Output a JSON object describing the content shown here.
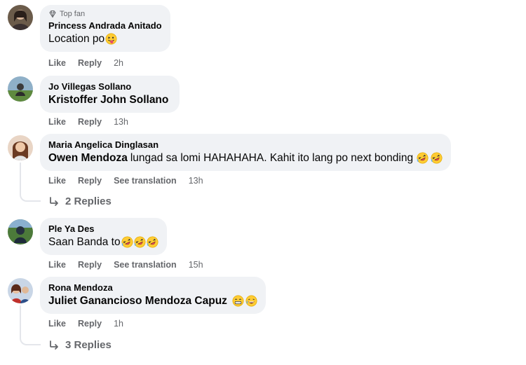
{
  "comments": [
    {
      "badge": "Top fan",
      "author": "Princess Andrada Anitado",
      "tag": "",
      "text": "Location po",
      "emojis": [
        "tongue"
      ],
      "like": "Like",
      "reply": "Reply",
      "translation": "",
      "time": "2h"
    },
    {
      "badge": "",
      "author": "Jo Villegas Sollano",
      "tag": "Kristoffer John Sollano",
      "text": "",
      "emojis": [],
      "like": "Like",
      "reply": "Reply",
      "translation": "",
      "time": "13h"
    },
    {
      "badge": "",
      "author": "Maria Angelica Dinglasan",
      "tag": "Owen Mendoza",
      "text": "lungad sa lomi HAHAHAHA. Kahit ito lang po next bonding",
      "emojis": [
        "rofl",
        "rofl"
      ],
      "like": "Like",
      "reply": "Reply",
      "translation": "See translation",
      "time": "13h",
      "replies": "2 Replies"
    },
    {
      "badge": "",
      "author": "Ple Ya Des",
      "tag": "",
      "text": "Saan Banda to",
      "emojis": [
        "rofl",
        "rofl",
        "rofl"
      ],
      "like": "Like",
      "reply": "Reply",
      "translation": "See translation",
      "time": "15h"
    },
    {
      "badge": "",
      "author": "Rona Mendoza",
      "tag": "Juliet Ganancioso Mendoza Capuz",
      "text": "",
      "emojis": [
        "grin",
        "laugh"
      ],
      "like": "Like",
      "reply": "Reply",
      "translation": "",
      "time": "1h",
      "replies": "3 Replies"
    }
  ],
  "colors": {
    "bubble": "#f0f2f5",
    "secondary_text": "#65676b",
    "primary_text": "#050505"
  },
  "icons": {
    "badge": "diamond-icon",
    "replies": "reply-arrow-icon"
  }
}
